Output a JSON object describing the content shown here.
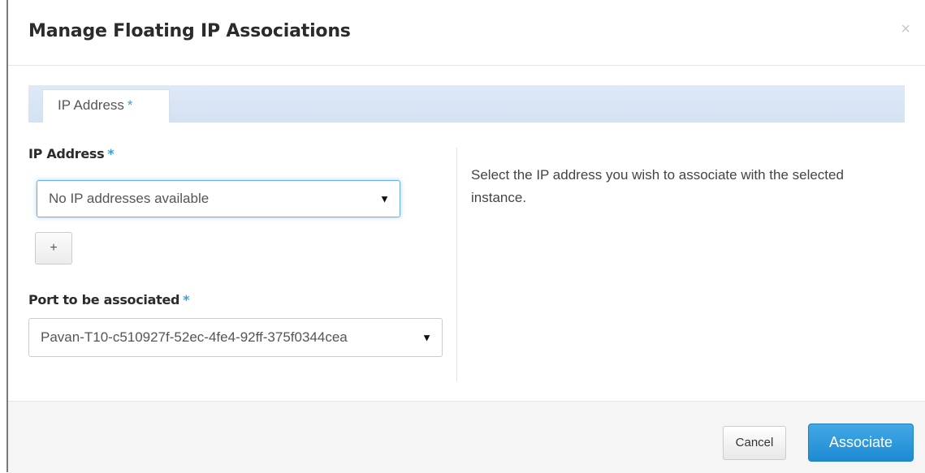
{
  "modal": {
    "title": "Manage Floating IP Associations",
    "close_glyph": "×"
  },
  "tabs": [
    {
      "label": "IP Address",
      "required_mark": "*"
    }
  ],
  "form": {
    "ip_address": {
      "label": "IP Address",
      "required_mark": "*",
      "selected": "No IP addresses available",
      "caret": "▼"
    },
    "add_ip_button": {
      "label": "+"
    },
    "port": {
      "label": "Port to be associated",
      "required_mark": "*",
      "selected": "Pavan-T10-c510927f-52ec-4fe4-92ff-375f0344cea",
      "caret": "▼"
    }
  },
  "help": {
    "text": "Select the IP address you wish to associate with the selected instance."
  },
  "footer": {
    "cancel_label": "Cancel",
    "associate_label": "Associate"
  },
  "colors": {
    "primary": "#1d8ad2",
    "required": "#3ba0d7",
    "tabbar": "#d3e1f3",
    "focus_ring": "#66afe9"
  }
}
